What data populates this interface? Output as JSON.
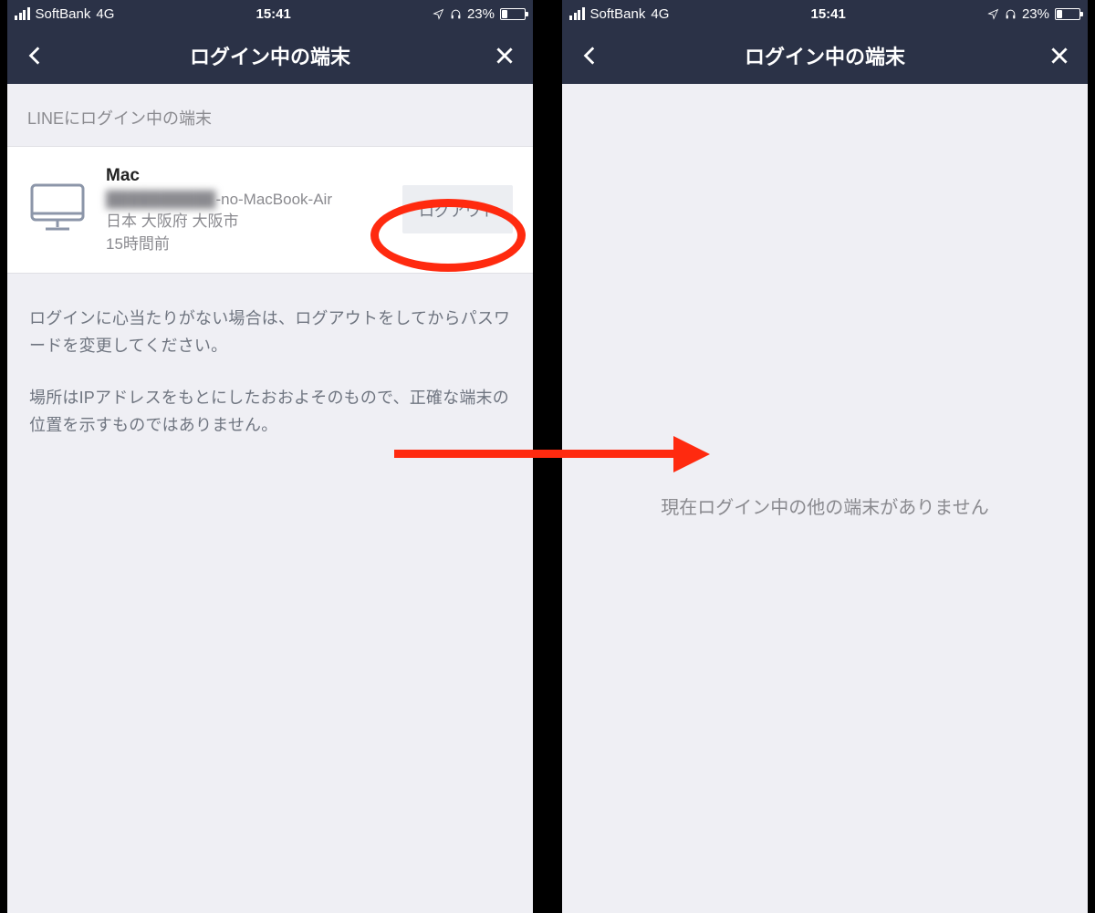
{
  "status": {
    "carrier": "SoftBank",
    "network": "4G",
    "time": "15:41",
    "battery_pct": "23%"
  },
  "nav": {
    "title": "ログイン中の端末"
  },
  "left": {
    "section_label": "LINEにログイン中の端末",
    "device": {
      "name": "Mac",
      "host_redacted": "██████████",
      "host_suffix": "-no-MacBook-Air",
      "location": "日本 大阪府 大阪市",
      "time_ago": "15時間前",
      "logout_label": "ログアウト"
    },
    "info_p1": "ログインに心当たりがない場合は、ログアウトをしてからパスワードを変更してください。",
    "info_p2": "場所はIPアドレスをもとにしたおおよそのもので、正確な端末の位置を示すものではありません。"
  },
  "right": {
    "empty_message": "現在ログイン中の他の端末がありません"
  }
}
